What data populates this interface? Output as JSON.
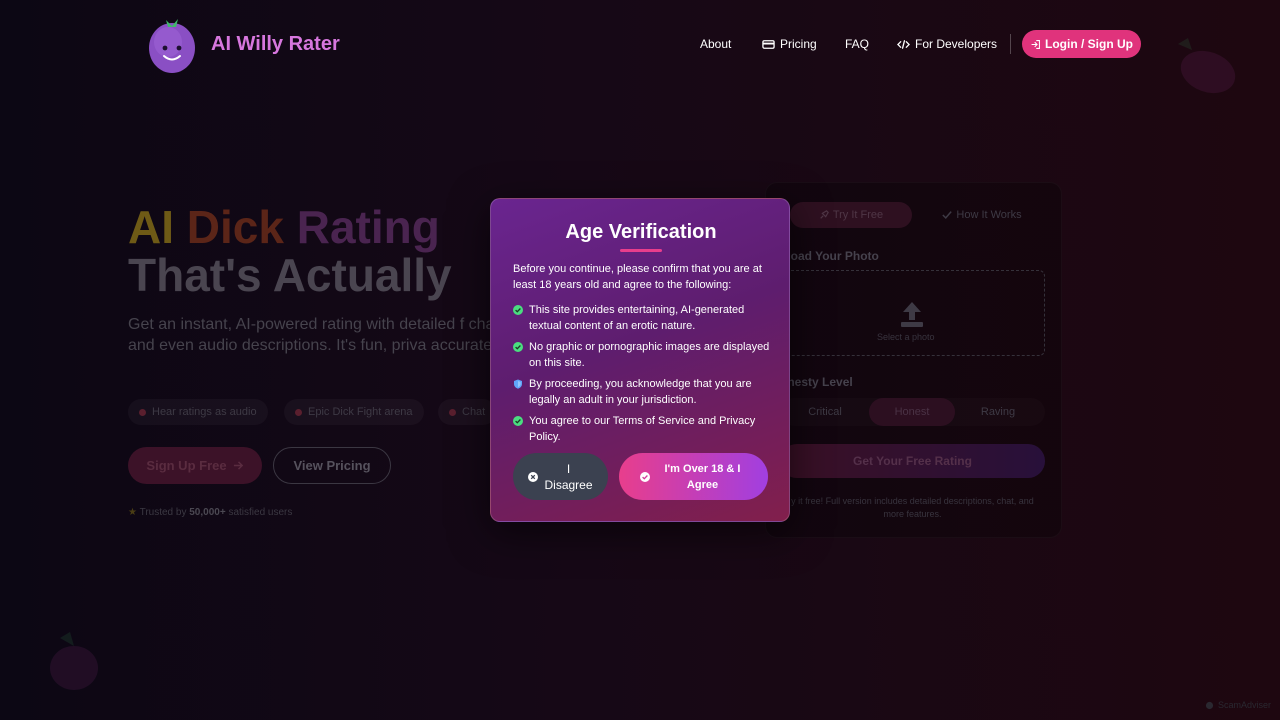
{
  "brand": {
    "name": "AI Willy Rater"
  },
  "nav": {
    "about": "About",
    "pricing": "Pricing",
    "faq": "FAQ",
    "developers": "For Developers",
    "login": "Login / Sign Up"
  },
  "hero": {
    "title_word1": "AI",
    "title_word2": "Dick",
    "title_word3": "Rating",
    "title_line2": "That's Actually",
    "subtitle": "Get an instant, AI-powered rating with detailed f chat, and even audio descriptions. It's fun, priva accurate!",
    "features": [
      "Hear ratings as audio",
      "Epic Dick Fight arena",
      "Chat"
    ],
    "signup_button": "Sign Up Free",
    "pricing_button": "View Pricing",
    "trusted_prefix": "Trusted by",
    "trusted_count": "50,000+",
    "trusted_suffix": "satisfied users"
  },
  "card": {
    "tab_try": "Try It Free",
    "tab_how": "How It Works",
    "upload_title": "pload Your Photo",
    "upload_label": "Select a photo",
    "honesty_title": "onesty Level",
    "honesty_options": [
      "Critical",
      "Honest",
      "Raving"
    ],
    "honesty_selected": "Honest",
    "submit": "Get Your Free Rating",
    "note": "y it free! Full version includes detailed descriptions, chat, and more features."
  },
  "modal": {
    "title": "Age Verification",
    "intro": "Before you continue, please confirm that you are at least 18 years old and agree to the following:",
    "points": [
      {
        "icon": "check-circle-icon",
        "text": "This site provides entertaining, AI-generated textual content of an erotic nature."
      },
      {
        "icon": "check-circle-icon",
        "text": "No graphic or pornographic images are displayed on this site."
      },
      {
        "icon": "shield-icon",
        "text": "By proceeding, you acknowledge that you are legally an adult in your jurisdiction."
      },
      {
        "icon": "check-circle-icon",
        "text": "You agree to our Terms of Service and Privacy Policy."
      }
    ],
    "disagree": "I Disagree",
    "agree": "I'm Over 18 & I Agree"
  },
  "watermark": "ScamAdviser",
  "colors": {
    "accent": "#e0337c",
    "brand_text": "#d777de",
    "modal_from": "#6a2590",
    "modal_to": "#821f4c",
    "check_green": "#4ade80"
  }
}
